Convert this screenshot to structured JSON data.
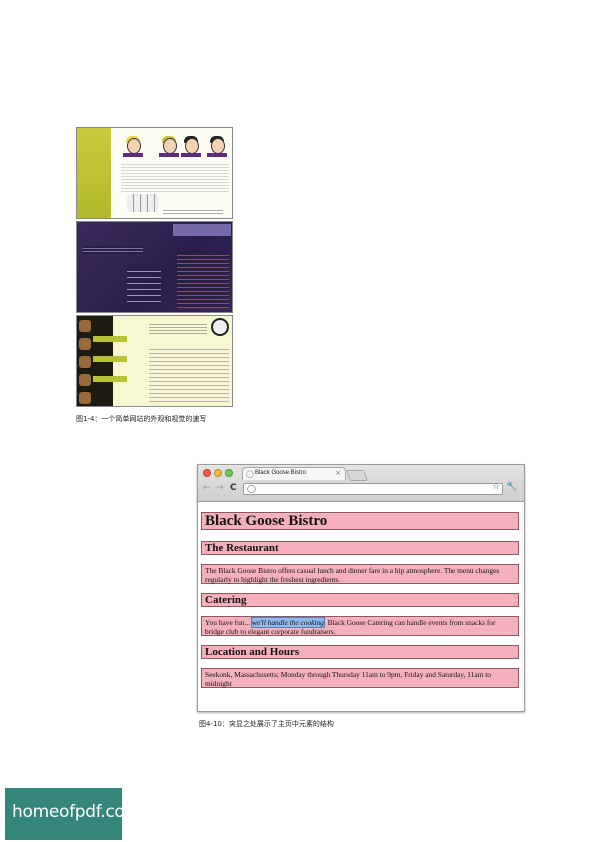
{
  "figure1": {
    "caption": "图1-4：一个简单网站的外观和视觉的速写"
  },
  "figure2": {
    "caption": "图4-10：突显之处展示了主页中元素的结构",
    "browser": {
      "tab_title": "Black Goose Bistro",
      "tab_close": "×",
      "back": "←",
      "forward": "→",
      "reload": "C",
      "star": "☆",
      "wrench": "🔧",
      "page_icon": "◯"
    },
    "page": {
      "heading": "Black Goose Bistro",
      "sections": [
        {
          "heading": "The Restaurant",
          "text": "The Black Goose Bistro offers casual lunch and dinner fare in a hip atmosphere. The menu changes regularly to highlight the freshest ingredients."
        },
        {
          "heading": "Catering",
          "text_before": "You have fun... ",
          "text_em": "we'll handle the cooking",
          "text_after": ". Black Goose Catering can handle events from snacks for bridge club to elegant corporate fundraisers."
        },
        {
          "heading": "Location and Hours",
          "text": "Seekonk, Massachusetts; Monday through Thursday 11am to 9pm, Friday and Saturday, 11am to midnight"
        }
      ]
    },
    "colors": {
      "highlight_box": "#f5b1bb",
      "emphasis": "#8fb8ea"
    }
  },
  "watermark": {
    "text": "homeofpdf.com"
  }
}
